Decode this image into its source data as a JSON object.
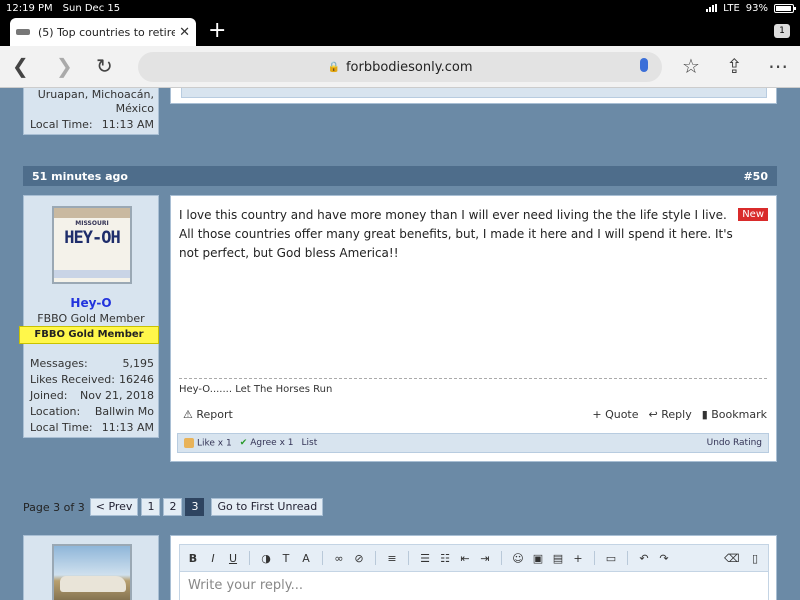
{
  "status_bar": {
    "time": "12:19 PM",
    "date": "Sun Dec 15",
    "network": "LTE",
    "battery": "93%",
    "battery_level": 0.93
  },
  "tabs": [
    {
      "title": "(5) Top countries to retire"
    }
  ],
  "tab_count": "1",
  "address_bar": {
    "url": "forbbodiesonly.com"
  },
  "prev_post": {
    "location": [
      "Uruapan, Michoacán,",
      "México"
    ],
    "local_time_label": "Local Time:",
    "local_time": "11:13 AM"
  },
  "post": {
    "time_ago": "51 minutes ago",
    "number": "#50",
    "author": {
      "avatar_text": "HEY-OH",
      "avatar_state": "MISSOURI",
      "name": "Hey-O",
      "title": "FBBO Gold Member",
      "badge": "FBBO Gold Member",
      "stats": [
        {
          "label": "Messages:",
          "value": "5,195"
        },
        {
          "label": "Likes Received:",
          "value": "16246"
        },
        {
          "label": "Joined:",
          "value": "Nov 21, 2018"
        },
        {
          "label": "Location:",
          "value": "Ballwin Mo"
        },
        {
          "label": "Local Time:",
          "value": "11:13 AM"
        }
      ]
    },
    "new_badge": "New",
    "message": "I love this country and have more money than I will ever need living the the life style I live. All those countries offer many great benefits, but, I made it here and I will spend it here. It's not perfect, but God bless America!!",
    "signature": "Hey-O....... Let The Horses Run",
    "actions": {
      "report": "Report",
      "quote": "+ Quote",
      "reply": "Reply",
      "bookmark": "Bookmark"
    },
    "likes": {
      "like": "Like x 1",
      "agree": "Agree x 1",
      "list": "List",
      "undo": "Undo Rating"
    }
  },
  "pagination": {
    "label": "Page 3 of 3",
    "prev": "< Prev",
    "pages": [
      "1",
      "2",
      "3"
    ],
    "current": "3",
    "first_unread": "Go to First Unread"
  },
  "editor": {
    "placeholder": "Write your reply..."
  }
}
